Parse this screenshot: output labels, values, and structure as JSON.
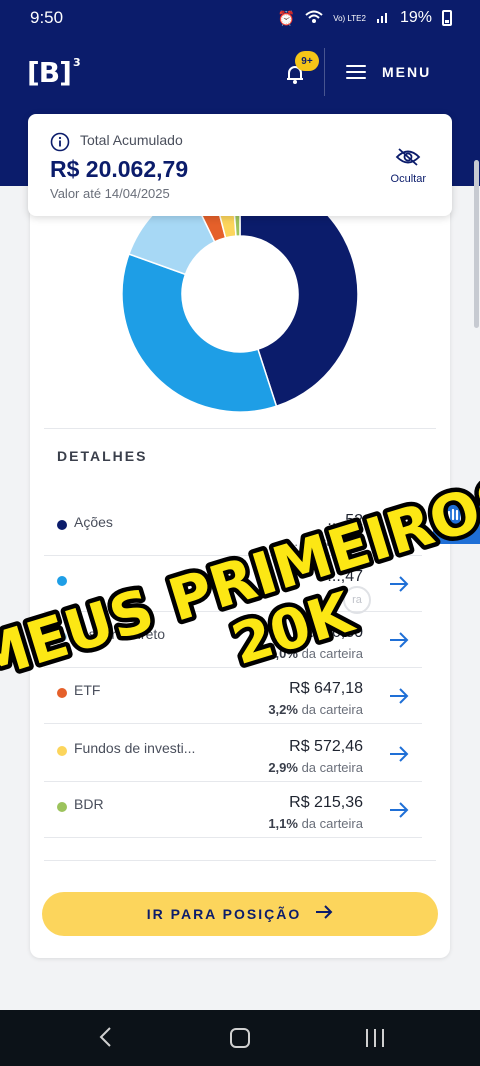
{
  "status_bar": {
    "time": "9:50",
    "network": "Vo) LTE2",
    "battery": "19%"
  },
  "header": {
    "logo": "B",
    "logo_sup": "3",
    "notification_badge": "9+",
    "menu_label": "MENU"
  },
  "summary": {
    "label": "Total Acumulado",
    "value": "R$ 20.062,79",
    "date": "Valor até 14/04/2025",
    "hide_label": "Ocultar"
  },
  "chart_data": {
    "type": "pie",
    "variant": "donut",
    "categories": [
      "Ações",
      "",
      "Tesouro Direto",
      "ETF",
      "Fundos de investi...",
      "BDR"
    ],
    "values": [
      45.0,
      35.5,
      12.3,
      3.2,
      2.9,
      1.1
    ],
    "colors": [
      "#0b1c6b",
      "#1e9ee6",
      "#a7d8f5",
      "#e5602a",
      "#fcd55c",
      "#9cc35c"
    ],
    "start_angle_deg": 0
  },
  "details": {
    "title": "DETALHES",
    "rows": [
      {
        "name": "Ações",
        "amount": "...,52",
        "pct_bold": "",
        "pct_rest": "... da carteira",
        "color": "#0b1c6b"
      },
      {
        "name": "",
        "amount": "...,47",
        "pct_bold": "",
        "pct_rest": "",
        "color": "#1e9ee6"
      },
      {
        "name": "Tesouro Direto",
        "amount": "...606,80",
        "pct_bold": "...,0%",
        "pct_rest": " da carteira",
        "color": "#a7d8f5"
      },
      {
        "name": "ETF",
        "amount": "R$ 647,18",
        "pct_bold": "3,2%",
        "pct_rest": " da carteira",
        "color": "#e5602a"
      },
      {
        "name": "Fundos de investi...",
        "amount": "R$ 572,46",
        "pct_bold": "2,9%",
        "pct_rest": " da carteira",
        "color": "#fcd55c"
      },
      {
        "name": "BDR",
        "amount": "R$ 215,36",
        "pct_bold": "1,1%",
        "pct_rest": " da carteira",
        "color": "#9cc35c"
      }
    ]
  },
  "cta": {
    "label": "IR PARA POSIÇÃO"
  },
  "overlay_caption": {
    "line1": "MEUS PRIMEIROS",
    "line2": "20K"
  },
  "ghost_circle_text": "ra"
}
